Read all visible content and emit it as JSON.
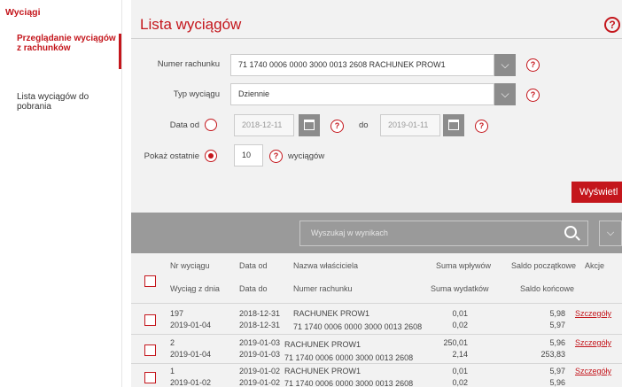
{
  "sidebar": {
    "title": "Wyciągi",
    "items": [
      {
        "label": "Przeglądanie wyciągów z rachunków"
      },
      {
        "label": "Lista wyciągów do pobrania"
      }
    ]
  },
  "page": {
    "title": "Lista wyciągów",
    "help": "?"
  },
  "form": {
    "account_label": "Numer rachunku",
    "account_value": "71 1740 0006 0000 3000 0013 2608 RACHUNEK PROW1",
    "type_label": "Typ wyciągu",
    "type_value": "Dziennie",
    "date_from_label": "Data od",
    "date_from_value": "2018-12-11",
    "to_label": "do",
    "date_to_value": "2019-01-11",
    "last_label": "Pokaż ostatnie",
    "last_value": "10",
    "last_suffix": "wyciągów",
    "show_button": "Wyświetl",
    "help": "?",
    "dropdown_glyph": "⌵"
  },
  "search": {
    "placeholder": "Wyszukaj w wynikach",
    "expand_glyph": "⌵"
  },
  "table": {
    "headers": {
      "nr": "Nr wyciągu",
      "date_from": "Data od",
      "owner": "Nazwa właściciela",
      "income": "Suma wpływów",
      "open_bal": "Saldo początkowe",
      "actions": "Akcje",
      "date_of": "Wyciąg z dnia",
      "date_to": "Data do",
      "account": "Numer rachunku",
      "expense": "Suma wydatków",
      "close_bal": "Saldo końcowe"
    },
    "rows": [
      {
        "nr": "197",
        "date": "2019-01-04",
        "from": "2018-12-31",
        "to": "2018-12-31",
        "owner": "RACHUNEK PROW1",
        "account": "71 1740 0006 0000 3000 0013 2608",
        "income": "0,01",
        "expense": "0,02",
        "open": "5,98",
        "close": "5,97",
        "action": "Szczegóły"
      },
      {
        "nr": "2",
        "date": "2019-01-04",
        "from": "2019-01-03",
        "to": "2019-01-03",
        "owner": "RACHUNEK PROW1",
        "account": "71 1740 0006 0000 3000 0013 2608",
        "income": "250,01",
        "expense": "2,14",
        "open": "5,96",
        "close": "253,83",
        "action": "Szczegóły"
      },
      {
        "nr": "1",
        "date": "2019-01-02",
        "from": "2019-01-02",
        "to": "2019-01-02",
        "owner": "RACHUNEK PROW1",
        "account": "71 1740 0006 0000 3000 0013 2608",
        "income": "0,01",
        "expense": "0,02",
        "open": "5,97",
        "close": "5,96",
        "action": "Szczegóły"
      }
    ]
  },
  "colors": {
    "accent": "#c4161c",
    "panel": "#f2f2f2",
    "bar": "#9a9a9a"
  }
}
